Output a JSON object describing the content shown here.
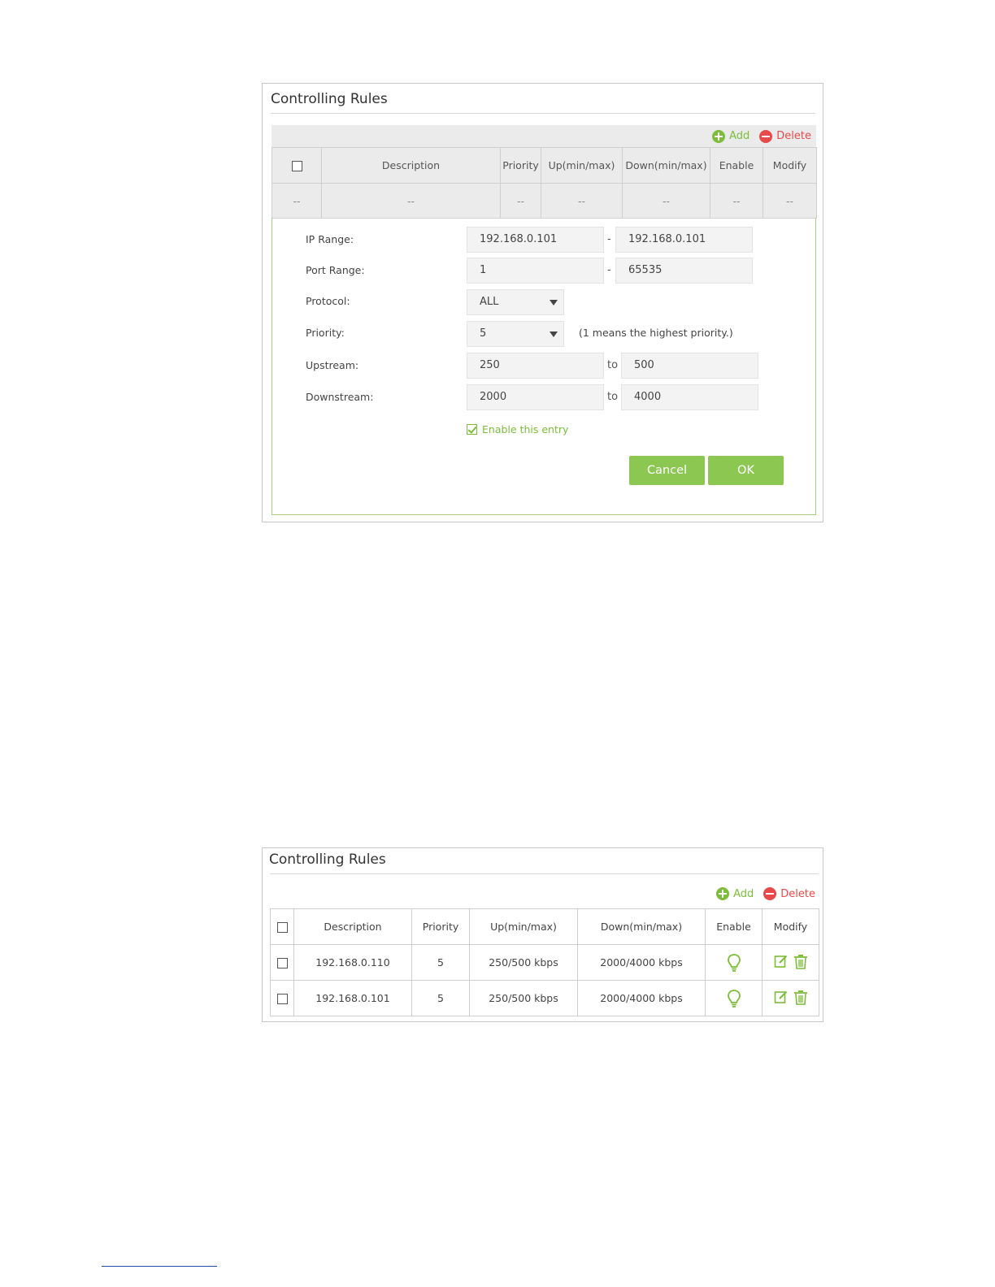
{
  "panel1": {
    "title": "Controlling Rules",
    "toolbar": {
      "add_label": "Add",
      "delete_label": "Delete"
    },
    "columns": [
      "Description",
      "Priority",
      "Up(min/max)",
      "Down(min/max)",
      "Enable",
      "Modify"
    ],
    "empty_row": [
      "--",
      "--",
      "--",
      "--",
      "--",
      "--",
      "--"
    ],
    "form": {
      "ip_range": {
        "label": "IP Range:",
        "from": "192.168.0.101",
        "sep": "-",
        "to": "192.168.0.101"
      },
      "port_range": {
        "label": "Port Range:",
        "from": "1",
        "sep": "-",
        "to": "65535"
      },
      "protocol": {
        "label": "Protocol:",
        "value": "ALL"
      },
      "priority": {
        "label": "Priority:",
        "value": "5",
        "hint": "(1 means the highest priority.)"
      },
      "upstream": {
        "label": "Upstream:",
        "min": "250",
        "sep": "to",
        "max": "500"
      },
      "downstream": {
        "label": "Downstream:",
        "min": "2000",
        "sep": "to",
        "max": "4000"
      },
      "enable_label": "Enable this entry",
      "enable_checked": true,
      "cancel_label": "Cancel",
      "ok_label": "OK"
    }
  },
  "panel2": {
    "title": "Controlling Rules",
    "toolbar": {
      "add_label": "Add",
      "delete_label": "Delete"
    },
    "columns": [
      "Description",
      "Priority",
      "Up(min/max)",
      "Down(min/max)",
      "Enable",
      "Modify"
    ],
    "rows": [
      {
        "description": "192.168.0.110",
        "priority": "5",
        "up": "250/500 kbps",
        "down": "2000/4000 kbps",
        "enabled": true
      },
      {
        "description": "192.168.0.101",
        "priority": "5",
        "up": "250/500 kbps",
        "down": "2000/4000 kbps",
        "enabled": true
      }
    ]
  },
  "colors": {
    "accent_green": "#7cbd3a",
    "button_green": "#8cc851",
    "delete_red": "#e84a4a",
    "icons": [
      "plus-circle-icon",
      "minus-circle-icon",
      "bulb-icon",
      "edit-icon",
      "trash-icon",
      "caret-down-icon",
      "checkbox-icon"
    ]
  }
}
